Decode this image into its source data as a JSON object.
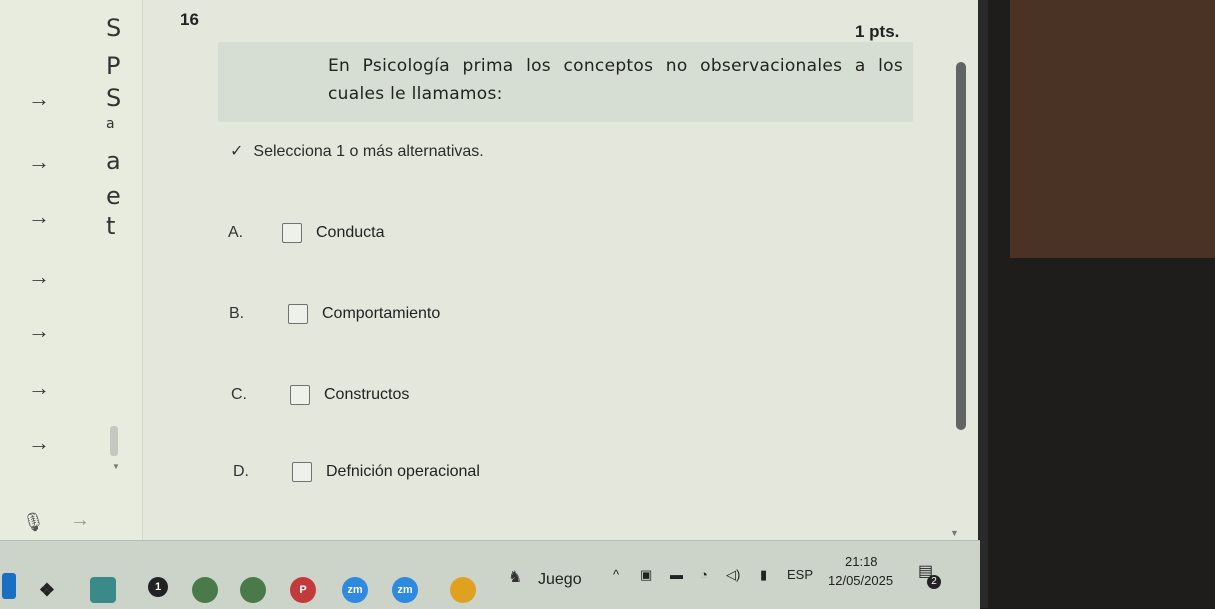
{
  "question": {
    "number": "16",
    "points": "1 pts.",
    "text": "En Psicología prima los conceptos no observacionales a los cuales le llamamos:",
    "instruction": "Selecciona 1 o más alternativas."
  },
  "options": [
    {
      "letter": "A.",
      "label": "Conducta"
    },
    {
      "letter": "B.",
      "label": "Comportamiento"
    },
    {
      "letter": "C.",
      "label": "Constructos"
    },
    {
      "letter": "D.",
      "label": "Defnición operacional"
    }
  ],
  "left_nav": {
    "letters": [
      "S",
      "P",
      "S",
      "a",
      "a",
      "e",
      "t"
    ]
  },
  "taskbar": {
    "search_label": "Juego",
    "apps": [
      "zm",
      "zm",
      "P"
    ],
    "language": "ESP",
    "time": "21:18",
    "date": "12/05/2025",
    "notification_count": "2"
  },
  "icons": {
    "check": "checkmark-icon",
    "arrow": "arrow-right-icon",
    "mic": "microphone-icon"
  }
}
